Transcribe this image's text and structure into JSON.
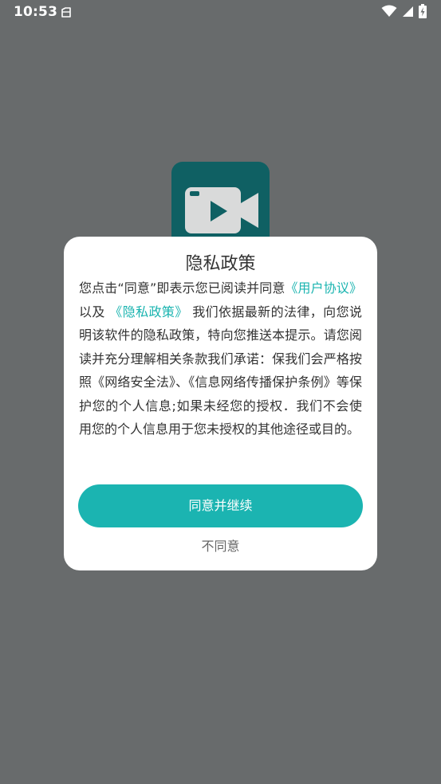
{
  "status_bar": {
    "time": "10:53",
    "icons": [
      "notification-icon",
      "wifi-icon",
      "signal-icon",
      "battery-icon"
    ]
  },
  "app": {
    "icon": "video-camera-icon",
    "icon_color": "#0f6063"
  },
  "dialog": {
    "title": "隐私政策",
    "body": {
      "t1": "您点击“同意”即表示您已阅读并同意",
      "link_user_agreement": "《用户协议》",
      "t2": "以及",
      "link_privacy_policy": "《隐私政策》",
      "t3": "我们依据最新的法律，向您说明该软件的隐私政策，特向您推送本提示。请您阅读并充分理解相关条款我们承诺：保我们会严格按照《网络安全法》、《信息网络传播保护条例》等保护您的个人信息;如果未经您的授权．我们不会使用您的个人信息用于您未授权的其他途径或目的。"
    },
    "agree_label": "同意并继续",
    "disagree_label": "不同意",
    "accent_color": "#1bb4b1"
  }
}
